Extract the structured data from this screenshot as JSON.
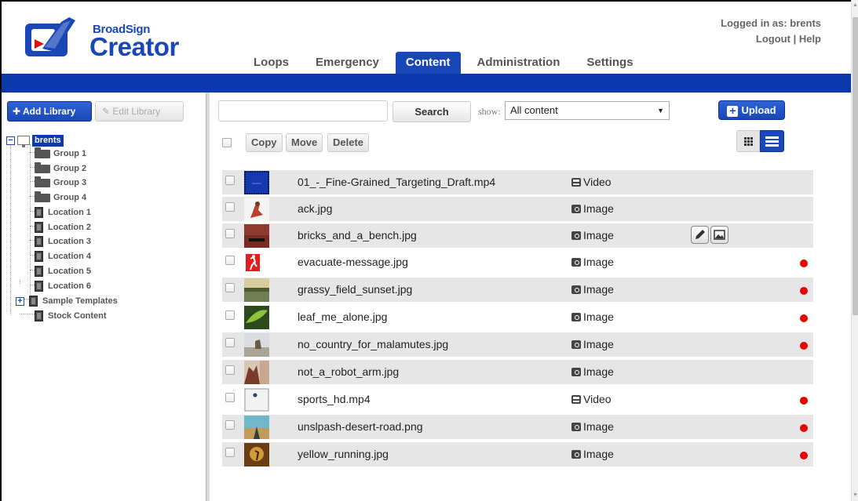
{
  "brand": {
    "top": "BroadSign",
    "bottom": "Creator"
  },
  "user": {
    "logged_in": "Logged in as: brents",
    "logout": "Logout",
    "separator": " | ",
    "help": "Help"
  },
  "nav": {
    "tabs": [
      {
        "label": "Loops"
      },
      {
        "label": "Emergency"
      },
      {
        "label": "Content",
        "active": true
      },
      {
        "label": "Administration"
      },
      {
        "label": "Settings"
      }
    ]
  },
  "sidebar": {
    "add_library": "Add Library",
    "edit_library": "Edit Library",
    "tree": {
      "root": "brents",
      "items": [
        "Group 1",
        "Group 2",
        "Group 3",
        "Group 4",
        "Location 1",
        "Location 2",
        "Location 3",
        "Location 4",
        "Location 5",
        "Location 6",
        "Sample Templates",
        "Stock Content"
      ]
    }
  },
  "toolbar": {
    "search_placeholder": "",
    "search_label": "Search",
    "show_label": "show:",
    "show_value": "All content",
    "upload_label": "Upload",
    "copy": "Copy",
    "move": "Move",
    "delete": "Delete"
  },
  "content": {
    "rows": [
      {
        "name": "01_-_Fine-Grained_Targeting_Draft.mp4",
        "type": "Video",
        "icon": "film-icon",
        "flag": false
      },
      {
        "name": "ack.jpg",
        "type": "Image",
        "icon": "camera-icon",
        "flag": false
      },
      {
        "name": "bricks_and_a_bench.jpg",
        "type": "Image",
        "icon": "camera-icon",
        "flag": false,
        "hover": true
      },
      {
        "name": "evacuate-message.jpg",
        "type": "Image",
        "icon": "camera-icon",
        "flag": true
      },
      {
        "name": "grassy_field_sunset.jpg",
        "type": "Image",
        "icon": "camera-icon",
        "flag": true
      },
      {
        "name": "leaf_me_alone.jpg",
        "type": "Image",
        "icon": "camera-icon",
        "flag": true
      },
      {
        "name": "no_country_for_malamutes.jpg",
        "type": "Image",
        "icon": "camera-icon",
        "flag": true
      },
      {
        "name": "not_a_robot_arm.jpg",
        "type": "Image",
        "icon": "camera-icon",
        "flag": false
      },
      {
        "name": "sports_hd.mp4",
        "type": "Video",
        "icon": "film-icon",
        "flag": true
      },
      {
        "name": "unslpash-desert-road.png",
        "type": "Image",
        "icon": "camera-icon",
        "flag": true
      },
      {
        "name": "yellow_running.jpg",
        "type": "Image",
        "icon": "camera-icon",
        "flag": true
      }
    ]
  },
  "colors": {
    "brand_blue": "#1a47b8",
    "bar_blue": "#0c3aad",
    "flag_red": "#e00000"
  }
}
